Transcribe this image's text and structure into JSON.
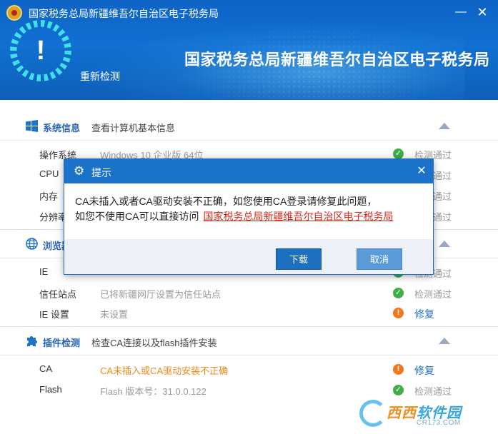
{
  "app": {
    "title": "国家税务总局新疆维吾尔自治区电子税务局",
    "minimize": "—",
    "close": "✕"
  },
  "banner": {
    "status_mark": "!",
    "recheck_label": "重新检测",
    "title": "国家税务总局新疆维吾尔自治区电子税务局"
  },
  "sections": {
    "system": {
      "name": "系统信息",
      "desc": "查看计算机基本信息",
      "rows": [
        {
          "label": "操作系统",
          "value": "Windows 10 企业版 64位",
          "status": "检测通过"
        },
        {
          "label": "CPU",
          "value": "",
          "status": "检测通过"
        },
        {
          "label": "内存",
          "value": "",
          "status": "检测通过"
        },
        {
          "label": "分辨率",
          "value": "",
          "status": "检测通过"
        }
      ]
    },
    "browser": {
      "name": "浏览器",
      "desc": "",
      "rows": [
        {
          "label": "IE",
          "value": "",
          "status": "检测通过"
        },
        {
          "label": "信任站点",
          "value": "已将新疆网厅设置为信任站点",
          "status": "检测通过"
        },
        {
          "label": "IE 设置",
          "value": "未设置",
          "status": "修复"
        }
      ]
    },
    "plugin": {
      "name": "插件检测",
      "desc": "检查CA连接以及flash插件安装",
      "rows": [
        {
          "label": "CA",
          "value": "CA未插入或CA驱动安装不正确",
          "status": "修复"
        },
        {
          "label": "Flash",
          "value": "Flash 版本号：31.0.0.122",
          "status": "检测通过"
        }
      ]
    }
  },
  "modal": {
    "title": "提示",
    "close": "✕",
    "line1": "CA未插入或者CA驱动安装不正确，如您使用CA登录请修复此问题，",
    "line2": "如您不使用CA可以直接访问",
    "link": "国家税务总局新疆维吾尔自治区电子税务局",
    "download_label": "下载",
    "cancel_label": "取消"
  },
  "watermark": {
    "text_a": "西西",
    "text_b": "软件园",
    "url": "CR173.COM"
  },
  "colors": {
    "header_blue": "#1170d2",
    "ok_green": "#3fae49",
    "warn_orange": "#f0771e",
    "link_red": "#d6281b",
    "section_blue": "#2a64b4"
  }
}
